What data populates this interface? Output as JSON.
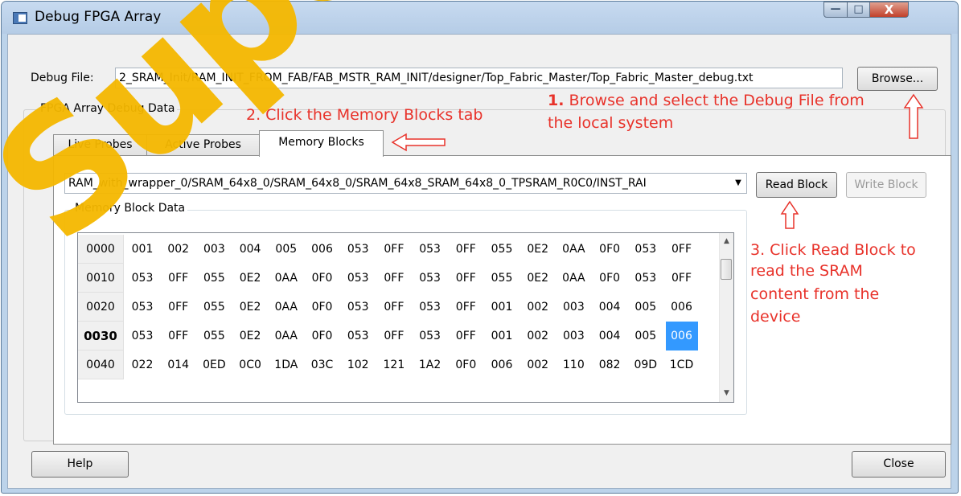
{
  "window": {
    "title": "Debug FPGA Array",
    "controls": {
      "minimize": "—",
      "maximize": "□",
      "close": "X"
    }
  },
  "debug_file": {
    "label": "Debug File:",
    "value": "2_SRAM_Init/RAM_INIT_FROM_FAB/FAB_MSTR_RAM_INIT/designer/Top_Fabric_Master/Top_Fabric_Master_debug.txt",
    "browse_label": "Browse..."
  },
  "group": {
    "title": "FPGA Array Debug Data"
  },
  "tabs": [
    {
      "label": "Live Probes",
      "active": false
    },
    {
      "label": "Active Probes",
      "active": false
    },
    {
      "label": "Memory Blocks",
      "active": true
    }
  ],
  "memory": {
    "block_select": "RAM_with_wrapper_0/SRAM_64x8_0/SRAM_64x8_0/SRAM_64x8_SRAM_64x8_0_TPSRAM_R0C0/INST_RAI",
    "read_label": "Read Block",
    "write_label": "Write Block",
    "data_title": "Memory Block Data",
    "rows": [
      {
        "addr": "0000",
        "bold": false,
        "cells": [
          "001",
          "002",
          "003",
          "004",
          "005",
          "006",
          "053",
          "0FF",
          "053",
          "0FF",
          "055",
          "0E2",
          "0AA",
          "0F0",
          "053",
          "0FF"
        ]
      },
      {
        "addr": "0010",
        "bold": false,
        "cells": [
          "053",
          "0FF",
          "055",
          "0E2",
          "0AA",
          "0F0",
          "053",
          "0FF",
          "053",
          "0FF",
          "055",
          "0E2",
          "0AA",
          "0F0",
          "053",
          "0FF"
        ]
      },
      {
        "addr": "0020",
        "bold": false,
        "cells": [
          "053",
          "0FF",
          "055",
          "0E2",
          "0AA",
          "0F0",
          "053",
          "0FF",
          "053",
          "0FF",
          "001",
          "002",
          "003",
          "004",
          "005",
          "006"
        ]
      },
      {
        "addr": "0030",
        "bold": true,
        "cells": [
          "053",
          "0FF",
          "055",
          "0E2",
          "0AA",
          "0F0",
          "053",
          "0FF",
          "053",
          "0FF",
          "001",
          "002",
          "003",
          "004",
          "005",
          "006"
        ]
      },
      {
        "addr": "0040",
        "bold": false,
        "cells": [
          "022",
          "014",
          "0ED",
          "0C0",
          "1DA",
          "03C",
          "102",
          "121",
          "1A2",
          "0F0",
          "006",
          "002",
          "110",
          "082",
          "09D",
          "1CD"
        ]
      }
    ],
    "selected": {
      "row": 3,
      "col": 15
    }
  },
  "buttons": {
    "help": "Help",
    "close": "Close"
  },
  "annotations": {
    "step1_num": "1.",
    "step1_line1": " Browse and select the Debug File from",
    "step1_line2": "the local system",
    "step2": "2. Click the Memory Blocks tab",
    "step3_line1": "3. Click Read Block to",
    "step3_line2": "read the SRAM",
    "step3_line3": "content from the",
    "step3_line4": "device"
  },
  "watermark": "Super",
  "colors": {
    "annotation": "#e8322a",
    "watermark": "#f5b800",
    "selection": "#3399ff",
    "title_bar": "#bcd3ea"
  }
}
